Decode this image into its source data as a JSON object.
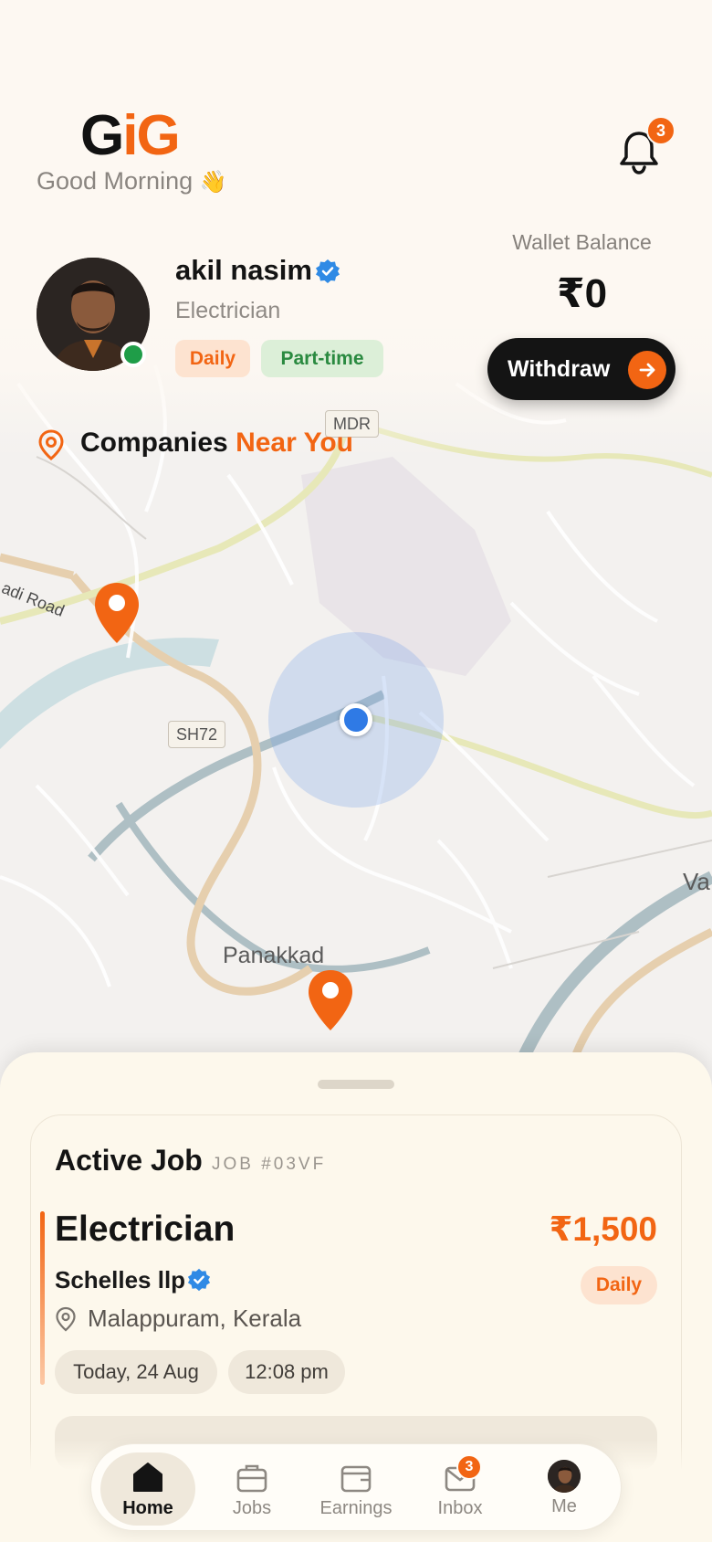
{
  "header": {
    "logo_g1": "G",
    "logo_i": "i",
    "logo_g2": "G",
    "greeting": "Good Morning",
    "greeting_emoji": "👋",
    "notification_count": "3"
  },
  "profile": {
    "name": "akil nasim",
    "role": "Electrician",
    "tags": [
      "Daily",
      "Part-time"
    ],
    "online": true
  },
  "wallet": {
    "label": "Wallet Balance",
    "amount": "₹0",
    "withdraw_label": "Withdraw"
  },
  "nearby": {
    "title": "Companies",
    "title_accent": "Near You"
  },
  "map": {
    "labels": {
      "mdr": "MDR",
      "sh72": "SH72",
      "road": "adi Road",
      "town": "Panakkad",
      "edge": "Va"
    }
  },
  "active_job": {
    "heading": "Active Job",
    "job_id": "JOB #03VF",
    "role": "Electrician",
    "pay": "₹1,500",
    "company": "Schelles llp",
    "type": "Daily",
    "location": "Malappuram, Kerala",
    "date": "Today, 24 Aug",
    "time": "12:08 pm"
  },
  "nav": {
    "items": [
      {
        "label": "Home",
        "icon": "home-icon",
        "active": true
      },
      {
        "label": "Jobs",
        "icon": "briefcase-icon",
        "active": false
      },
      {
        "label": "Earnings",
        "icon": "wallet-icon",
        "active": false
      },
      {
        "label": "Inbox",
        "icon": "mail-icon",
        "active": false,
        "badge": "3"
      },
      {
        "label": "Me",
        "icon": "avatar",
        "active": false
      }
    ]
  },
  "colors": {
    "accent": "#f26513",
    "verified": "#2f8ae5",
    "online": "#1f9d48"
  }
}
